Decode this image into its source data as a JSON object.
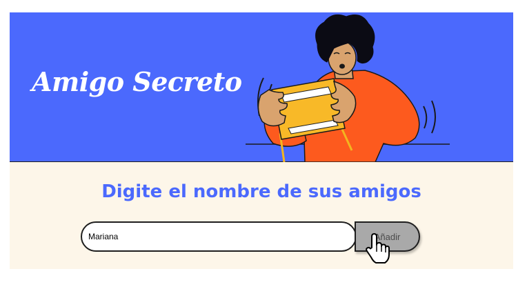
{
  "header": {
    "title": "Amigo Secreto",
    "background_color": "#4b69fd",
    "illustration_icon": "person-holding-game-controller-illustration"
  },
  "main": {
    "heading": "Digite el nombre de sus amigos",
    "heading_color": "#4b69fd",
    "background_color": "#fdf6e9",
    "friend_input": {
      "value": "Mariana",
      "placeholder": ""
    },
    "add_button": {
      "label": "Añadir",
      "background_color": "#a9a9a9"
    }
  },
  "cursor": {
    "icon": "hand-pointer-icon"
  }
}
